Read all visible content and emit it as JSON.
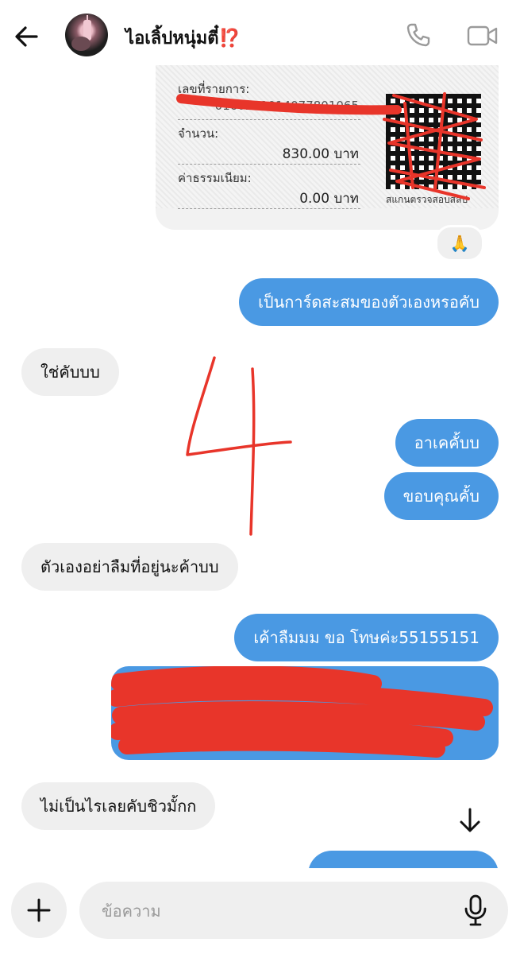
{
  "header": {
    "contact_name": "ไอเลิ้ปหนุ่มตี๋⁉️"
  },
  "slip": {
    "ref_label": "เลขที่รายการ:",
    "ref_value": "0160221014077801065",
    "amount_label": "จำนวน:",
    "amount_value": "830.00 บาท",
    "fee_label": "ค่าธรรมเนียม:",
    "fee_value": "0.00 บาท",
    "qr_caption": "สแกนตรวจสอบสลิป",
    "reaction": "🙏"
  },
  "messages": [
    {
      "side": "out",
      "text": "เป็นการ์ดสะสมของตัวเองหรอคับ"
    },
    {
      "side": "in",
      "text": "ใช่คับบบ"
    },
    {
      "side": "out",
      "text": "อาเคคั้บบ"
    },
    {
      "side": "out",
      "text": "ขอบคุณคั้บ"
    },
    {
      "side": "in",
      "text": "ตัวเองอย่าลืมที่อยู่นะค้าบบ"
    },
    {
      "side": "out",
      "text": "เค้าลืมมม ขอ โทษค่ะ55155151"
    },
    {
      "side": "in",
      "text": "ไม่เป็นไรเลยคับชิวมั้กก"
    }
  ],
  "annotation_text": "4",
  "composer": {
    "placeholder": "ข้อความ"
  },
  "colors": {
    "outgoing": "#4a99e3",
    "incoming": "#efefef",
    "redaction": "#e8352a"
  }
}
